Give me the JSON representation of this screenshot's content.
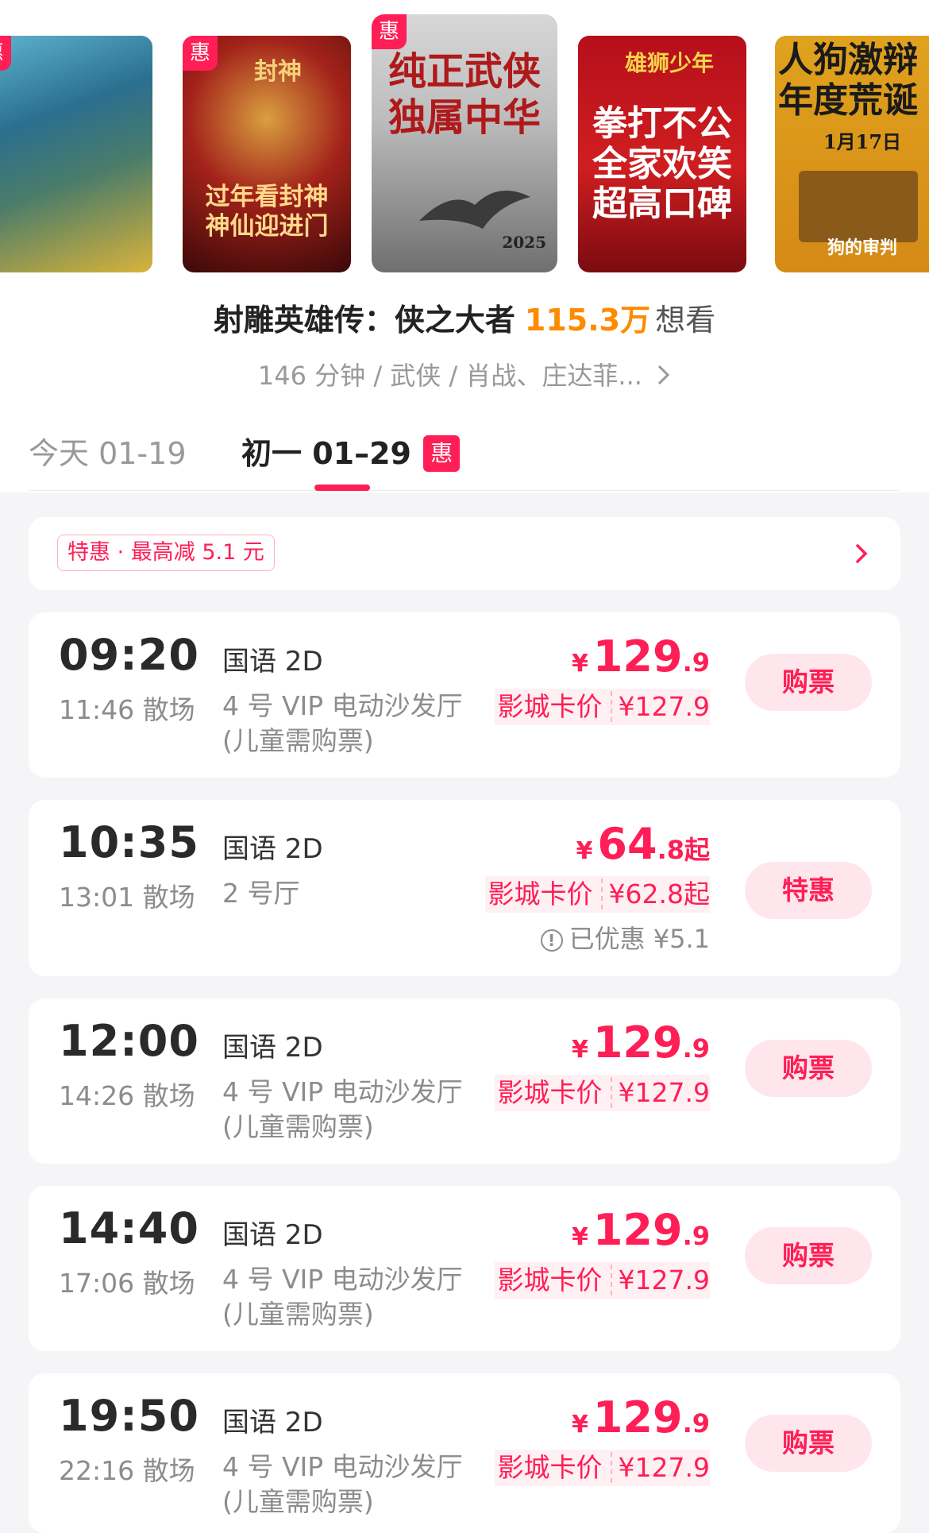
{
  "posters": [
    {
      "badge": "惠",
      "text": "",
      "color_top": "#5fb6d1"
    },
    {
      "badge": "惠",
      "text": "过年看封神\n神仙迎进门",
      "top_text": "封神"
    },
    {
      "badge": "惠",
      "text": "纯正武侠\n独属中华",
      "year": "2025"
    },
    {
      "badge": "",
      "text": "拳打不公\n全家欢笑\n超高口碑",
      "top_text": "雄狮少年"
    },
    {
      "badge": "",
      "text": "人狗激辩\n年度荒诞",
      "date": "1月17日",
      "bottom_text": "狗的审判"
    }
  ],
  "movie": {
    "title": "射雕英雄传：侠之大者",
    "want_count": "115.3万",
    "want_label": "想看",
    "meta": "146 分钟 / 武侠 / 肖战、庄达菲..."
  },
  "tabs": [
    {
      "label": "今天 01-19"
    },
    {
      "label": "初一 01–29",
      "badge": "惠"
    }
  ],
  "promo": {
    "label": "特惠 · 最高减 5.1 元"
  },
  "showtimes": [
    {
      "start": "09:20",
      "end": "11:46 散场",
      "lang": "国语 2D",
      "hall": "4 号 VIP 电动沙发厅\n(儿童需购票)",
      "price_yen": "¥",
      "price_int": "129",
      "price_dec": ".9",
      "price_suffix": "",
      "card_label": "影城卡价",
      "card_value": "¥127.9",
      "saved": "",
      "button": "购票"
    },
    {
      "start": "10:35",
      "end": "13:01 散场",
      "lang": "国语 2D",
      "hall": "2 号厅",
      "price_yen": "¥",
      "price_int": "64",
      "price_dec": ".8",
      "price_suffix": "起",
      "card_label": "影城卡价",
      "card_value": "¥62.8起",
      "saved": "已优惠 ¥5.1",
      "button": "特惠"
    },
    {
      "start": "12:00",
      "end": "14:26 散场",
      "lang": "国语 2D",
      "hall": "4 号 VIP 电动沙发厅\n(儿童需购票)",
      "price_yen": "¥",
      "price_int": "129",
      "price_dec": ".9",
      "price_suffix": "",
      "card_label": "影城卡价",
      "card_value": "¥127.9",
      "saved": "",
      "button": "购票"
    },
    {
      "start": "14:40",
      "end": "17:06 散场",
      "lang": "国语 2D",
      "hall": "4 号 VIP 电动沙发厅\n(儿童需购票)",
      "price_yen": "¥",
      "price_int": "129",
      "price_dec": ".9",
      "price_suffix": "",
      "card_label": "影城卡价",
      "card_value": "¥127.9",
      "saved": "",
      "button": "购票"
    },
    {
      "start": "19:50",
      "end": "22:16 散场",
      "lang": "国语 2D",
      "hall": "4 号 VIP 电动沙发厅\n(儿童需购票)",
      "price_yen": "¥",
      "price_int": "129",
      "price_dec": ".9",
      "price_suffix": "",
      "card_label": "影城卡价",
      "card_value": "¥127.9",
      "saved": "",
      "button": "购票"
    }
  ],
  "colors": {
    "accent": "#ff1e55",
    "want": "#ff8a00"
  }
}
